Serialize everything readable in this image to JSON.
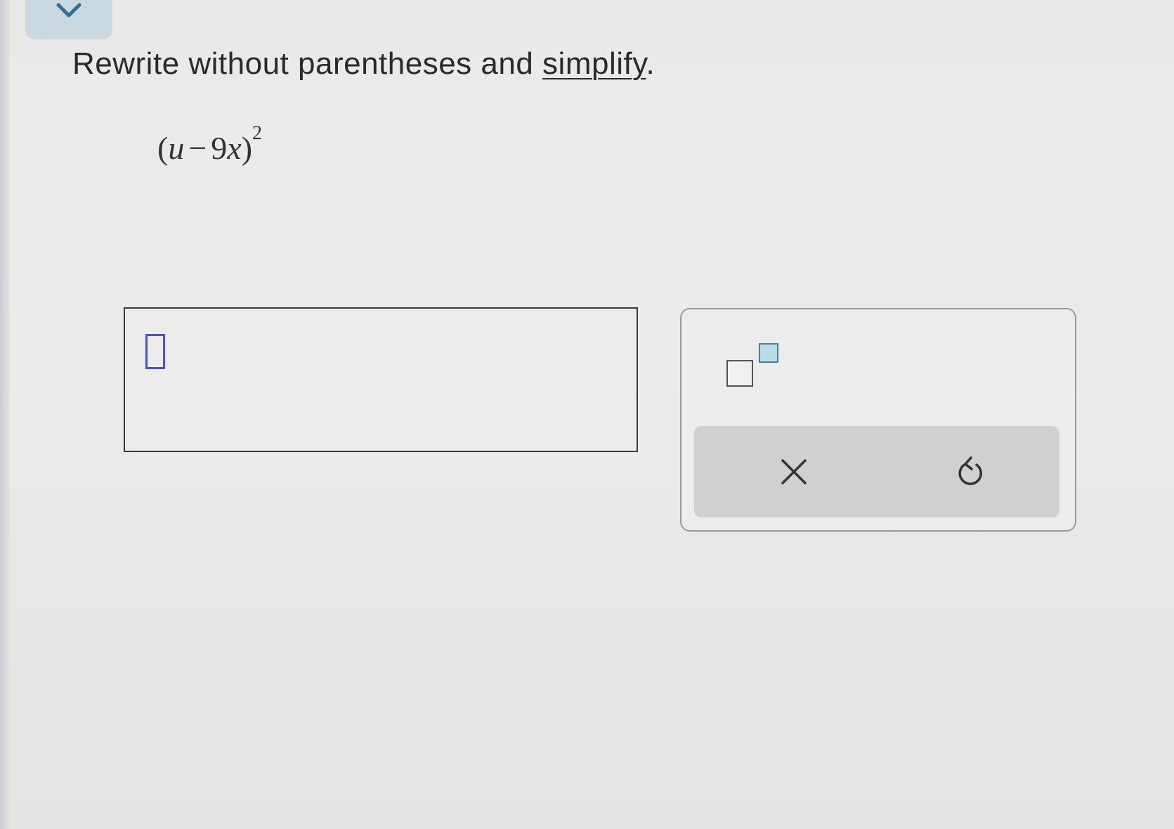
{
  "header": {
    "collapse_icon": "chevron-down-icon",
    "accent_color": "#c9d8de"
  },
  "question": {
    "prompt_before": "Rewrite without parentheses and ",
    "prompt_link": "simplify",
    "prompt_after": ".",
    "expression": {
      "open": "(",
      "var1": "u",
      "operator": "−",
      "coefficient": "9",
      "var2": "x",
      "close": ")",
      "exponent": "2"
    }
  },
  "answer": {
    "value": "",
    "cursor_color": "#4b4fd6"
  },
  "tools": {
    "exponent_icon": "superscript-template-icon",
    "clear_icon": "close-icon",
    "undo_icon": "undo-icon"
  }
}
